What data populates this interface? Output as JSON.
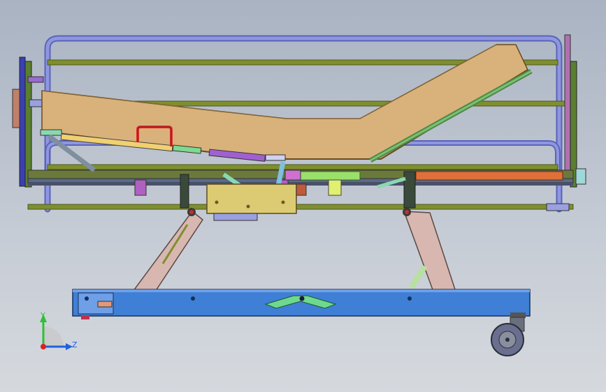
{
  "viewport": {
    "background_top": "#a9b3c2",
    "background_bottom": "#d5d9de"
  },
  "model": {
    "description_icon": "hospital-bed-cad-model",
    "colors": {
      "rail_blue": "#7f88d4",
      "rail_green": "#7f8f2f",
      "mattress": "#d8b27a",
      "base": "#3f7fd6",
      "scissor": "#d8b7b0",
      "handle": "#e03030",
      "wheel": "#7a7f8f",
      "motor_box": "#dccb73"
    }
  },
  "triad": {
    "y_label": "Y",
    "z_label": "Z",
    "y_color": "#2fc03a",
    "z_color": "#2060e0",
    "x_color": "#e02020"
  }
}
